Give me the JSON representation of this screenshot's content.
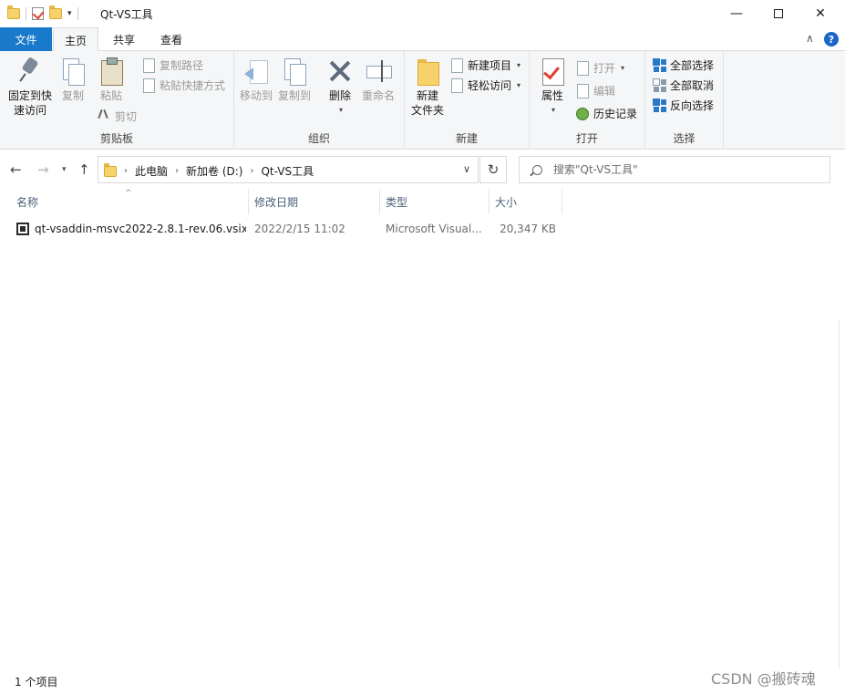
{
  "window": {
    "title": "Qt-VS工具",
    "minimize_glyph": "—",
    "close_glyph": "✕"
  },
  "ribbon_tabs": {
    "file": "文件",
    "home": "主页",
    "share": "共享",
    "view": "查看",
    "collapse_glyph": "∧",
    "help_glyph": "?"
  },
  "ribbon": {
    "clipboard": {
      "label": "剪贴板",
      "pin_line1": "固定到快",
      "pin_line2": "速访问",
      "copy": "复制",
      "paste": "粘贴",
      "copy_path": "复制路径",
      "paste_shortcut": "粘贴快捷方式",
      "cut": "剪切"
    },
    "organize": {
      "label": "组织",
      "move_to": "移动到",
      "copy_to": "复制到",
      "delete": "删除",
      "rename": "重命名"
    },
    "new": {
      "label": "新建",
      "new_folder_line1": "新建",
      "new_folder_line2": "文件夹",
      "new_item": "新建项目",
      "easy_access": "轻松访问"
    },
    "open": {
      "label": "打开",
      "properties": "属性",
      "open": "打开",
      "edit": "编辑",
      "history": "历史记录"
    },
    "select": {
      "label": "选择",
      "select_all": "全部选择",
      "select_none": "全部取消",
      "invert": "反向选择"
    }
  },
  "navigation": {
    "breadcrumbs": [
      "此电脑",
      "新加卷 (D:)",
      "Qt-VS工具"
    ],
    "search_placeholder": "搜索\"Qt-VS工具\""
  },
  "file_list": {
    "columns": [
      "名称",
      "修改日期",
      "类型",
      "大小"
    ],
    "rows": [
      {
        "name": "qt-vsaddin-msvc2022-2.8.1-rev.06.vsix",
        "modified": "2022/2/15 11:02",
        "type": "Microsoft Visual...",
        "size": "20,347 KB"
      }
    ]
  },
  "status": {
    "item_count": "1 个项目"
  },
  "watermark": "CSDN @搬砖魂",
  "colors": {
    "accent": "#1979ca",
    "ribbon_bg": "#f5f6f7",
    "header_text": "#4c607a"
  }
}
